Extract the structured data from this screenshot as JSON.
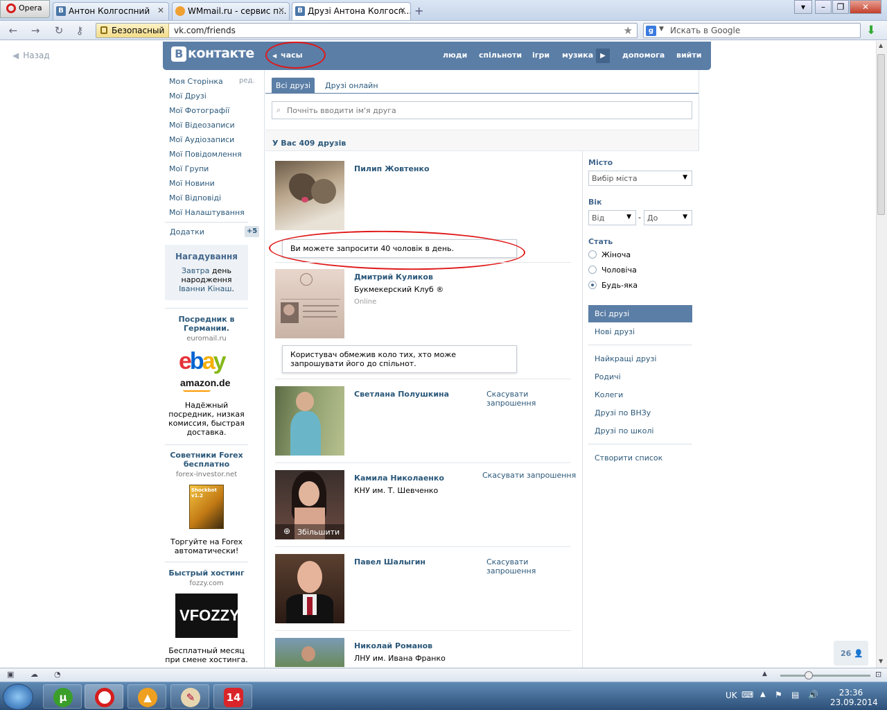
{
  "browser": {
    "menu_label": "Opera",
    "tabs": [
      {
        "title": "Антон Колгоспний",
        "favicon": "vk-icon"
      },
      {
        "title": "WMmail.ru - сервис п...",
        "favicon": "wmmail-icon"
      },
      {
        "title": "Друзі Антона Колгосп...",
        "favicon": "vk-icon"
      }
    ],
    "security_label": "Безопасный",
    "url": "vk.com/friends",
    "search_placeholder": "Искать в Google"
  },
  "page": {
    "back_label": "Назад",
    "logo": {
      "letter": "B",
      "text": "контакте"
    },
    "clock_label": "часы",
    "top_nav": [
      "люди",
      "спільноти",
      "ігри",
      "музика",
      "допомога",
      "вийти"
    ],
    "sidebar": {
      "edit_label": "ред.",
      "items": [
        "Моя Сторінка",
        "Мої Друзі",
        "Мої Фотографії",
        "Мої Відеозаписи",
        "Мої Аудіозаписи",
        "Мої Повідомлення",
        "Мої Групи",
        "Мої Новини",
        "Мої Відповіді",
        "Мої Налаштування"
      ],
      "apps_label": "Додатки",
      "apps_count": "+5"
    },
    "reminder": {
      "title": "Нагадування",
      "link1": "Завтра",
      "text1": "день народження",
      "link2": "Іванни Кінаш",
      "end": "."
    },
    "ads": [
      {
        "title": "Посредник в Германии.",
        "domain": "euromail.ru",
        "text": "Надёжный посредник, низкая комиссия, быстрая доставка.",
        "logo1": "ebay",
        "logo2": "amazon.de"
      },
      {
        "title": "Советники Forex бесплатно",
        "domain": "forex-investor.net",
        "text": "Торгуйте на Forex автоматически!",
        "box_label": "Shockbot v1.2"
      },
      {
        "title": "Быстрый хостинг",
        "domain": "fozzy.com",
        "text": "Бесплатный месяц при смене хостинга.",
        "logo": "FOZZY"
      }
    ],
    "friends_tabs": [
      "Всі друзі",
      "Друзі онлайн"
    ],
    "search_placeholder": "Почніть вводити ім'я друга",
    "friends_count": "У Вас 409 друзів",
    "friends": [
      {
        "name": "Пилип Жовтенко",
        "sub": "",
        "notice": "Ви можете запросити 40 чоловік в день."
      },
      {
        "name": "Дмитрий Куликов",
        "sub": "Букмекерский Клуб ®",
        "status": "Online",
        "notice": "Користувач обмежив коло тих, хто може запрошувати його до спільнот."
      },
      {
        "name": "Светлана Полушкина",
        "cancel": "Скасувати запрошення"
      },
      {
        "name": "Камила Николаенко",
        "sub": "КНУ им. Т. Шевченко",
        "cancel": "Скасувати запрошення",
        "zoom_label": "Збільшити"
      },
      {
        "name": "Павел Шалыгин",
        "cancel": "Скасувати запрошення"
      },
      {
        "name": "Николай Романов",
        "sub": "ЛНУ им. Ивана Франко"
      }
    ],
    "filter": {
      "city_label": "Місто",
      "city_select": "Вибір міста",
      "age_label": "Вік",
      "age_from": "Від",
      "age_dash": "-",
      "age_to": "До",
      "sex_label": "Стать",
      "sex_options": [
        "Жіноча",
        "Чоловіча",
        "Будь-яка"
      ],
      "sex_selected": "Будь-яка",
      "lists_active": "Всі друзі",
      "lists": [
        "Нові друзі",
        "Найкращі друзі",
        "Родичі",
        "Колеги",
        "Друзі по ВНЗу",
        "Друзі по школі",
        "Створити список"
      ]
    },
    "online_count": "26"
  },
  "taskbar": {
    "language": "UK",
    "time": "23:36",
    "date": "23.09.2014",
    "apps": [
      "utorrent-icon",
      "opera-icon",
      "aimp-icon",
      "paint-icon",
      "calendar-14-icon"
    ],
    "calendar_day": "14"
  },
  "colors": {
    "vk_blue": "#5b7ea6",
    "link": "#2b587a",
    "annotation_red": "#e01818"
  }
}
